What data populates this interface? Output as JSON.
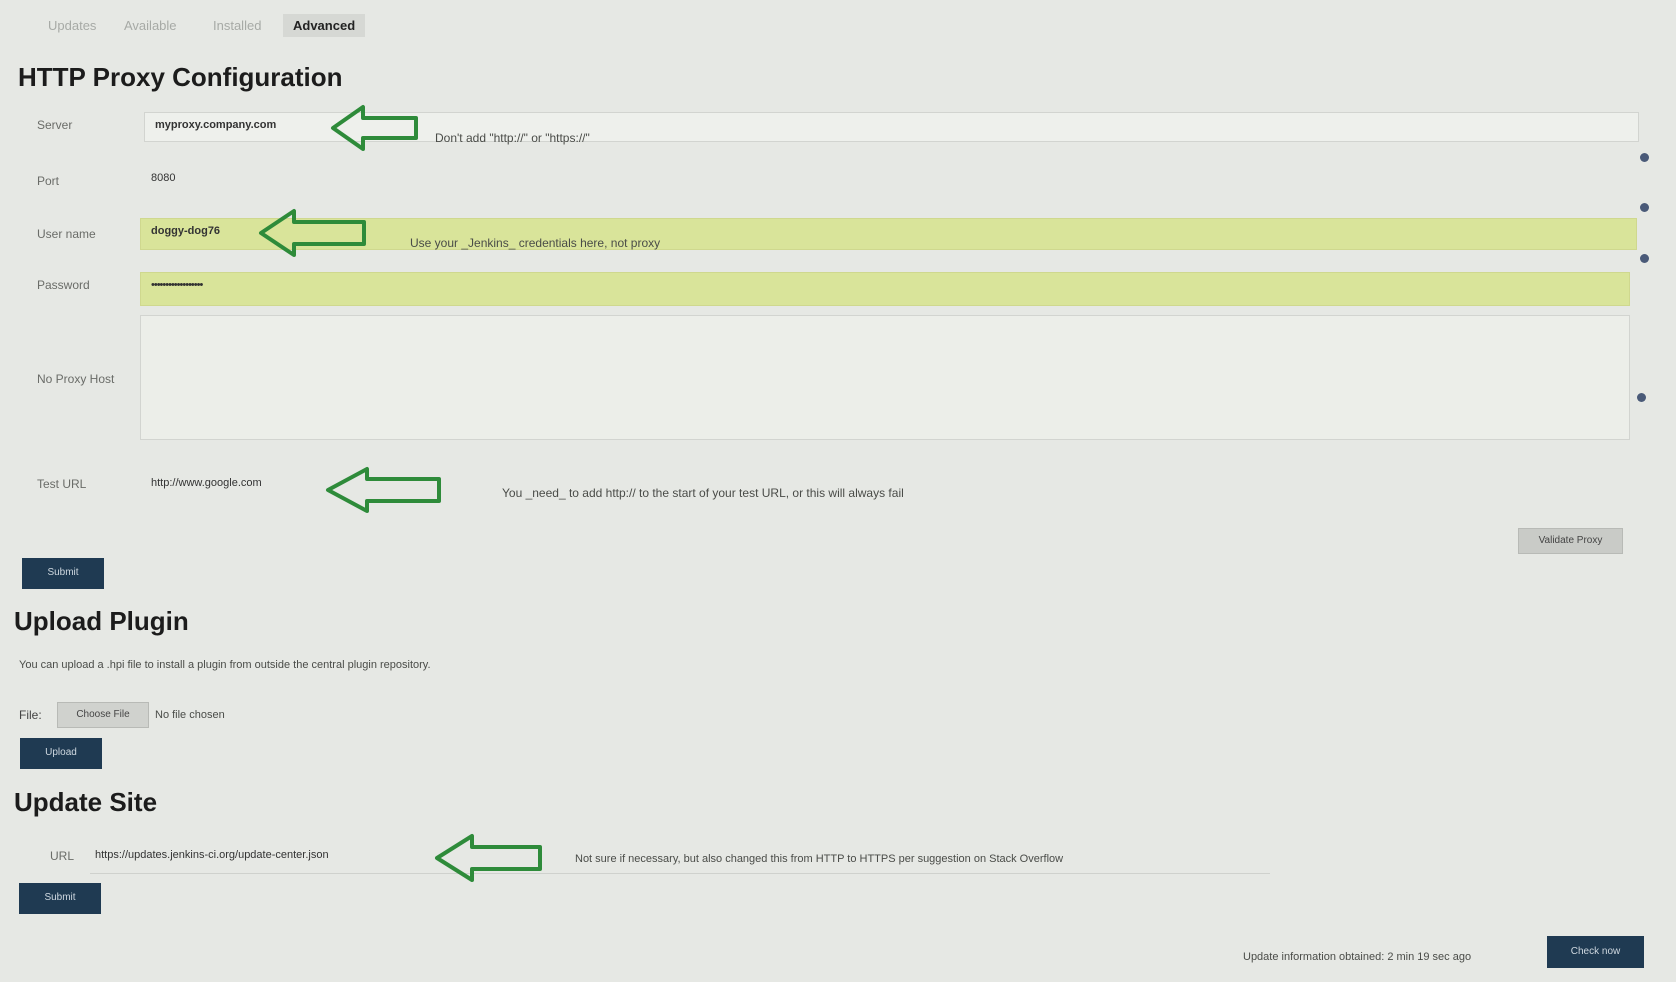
{
  "tabs": [
    {
      "label": "Updates"
    },
    {
      "label": "Available"
    },
    {
      "label": "Installed"
    },
    {
      "label": "Advanced"
    }
  ],
  "proxy": {
    "title": "HTTP Proxy Configuration",
    "server_label": "Server",
    "server_value": "myproxy.company.com",
    "server_note": "Don't add \"http://\" or \"https://\"",
    "port_label": "Port",
    "port_value": "8080",
    "username_label": "User name",
    "username_value": "doggy-dog76",
    "username_note": "Use your _Jenkins_ credentials here, not proxy",
    "password_label": "Password",
    "password_value": "••••••••••••••••••",
    "noproxy_label": "No Proxy Host",
    "noproxy_value": "",
    "testurl_label": "Test URL",
    "testurl_value": "http://www.google.com",
    "testurl_note": "You _need_ to add http:// to the start of your test URL, or this will always fail",
    "validate_label": "Validate Proxy",
    "submit_label": "Submit"
  },
  "upload": {
    "title": "Upload Plugin",
    "description": "You can upload a .hpi file to install a plugin from outside the central plugin repository.",
    "file_label": "File:",
    "choose_label": "Choose File",
    "no_file_text": "No file chosen",
    "upload_label": "Upload"
  },
  "update_site": {
    "title": "Update Site",
    "url_label": "URL",
    "url_value": "https://updates.jenkins-ci.org/update-center.json",
    "url_note": "Not sure if necessary, but also changed this from HTTP to HTTPS per suggestion on Stack Overflow",
    "submit_label": "Submit"
  },
  "footer": {
    "status_text": "Update information obtained: 2 min 19 sec ago",
    "check_now_label": "Check now"
  },
  "colors": {
    "button": "#1f3a52",
    "highlight": "#d9e49a",
    "annotation_arrow": "#2e8b3a"
  }
}
